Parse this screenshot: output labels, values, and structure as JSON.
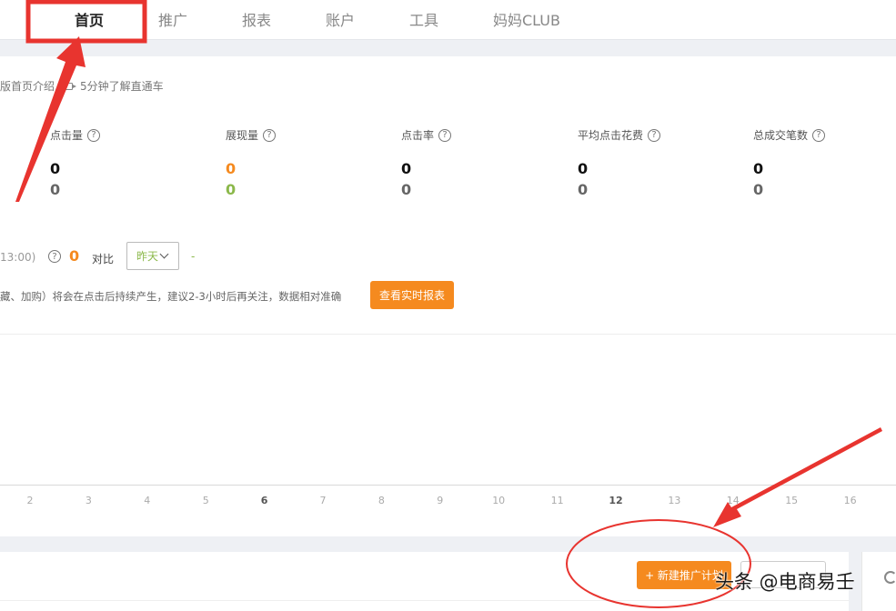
{
  "nav": {
    "items": [
      {
        "label": "首页",
        "active": true
      },
      {
        "label": "推广"
      },
      {
        "label": "报表"
      },
      {
        "label": "账户"
      },
      {
        "label": "工具"
      },
      {
        "label": "妈妈CLUB"
      }
    ]
  },
  "intro": {
    "home_intro": "版首页介绍",
    "video_link": "5分钟了解直通车"
  },
  "metrics": [
    {
      "label": "点击量",
      "today": "0",
      "yesterday": "0"
    },
    {
      "label": "展现量",
      "today": "0",
      "yesterday": "0"
    },
    {
      "label": "点击率",
      "today": "0",
      "yesterday": "0"
    },
    {
      "label": "平均点击花费",
      "today": "0",
      "yesterday": "0"
    },
    {
      "label": "总成交笔数",
      "today": "0",
      "yesterday": "0"
    }
  ],
  "realtime": {
    "time_range": "13:00)",
    "count": "0",
    "compare_label": "对比",
    "compare_value": "昨天",
    "dash": "-",
    "note": "藏、加购）将会在点击后持续产生，建议2-3小时后再关注，数据相对准确",
    "report_button": "查看实时报表"
  },
  "chart_axis": {
    "ticks": [
      "2",
      "3",
      "4",
      "5",
      "6",
      "7",
      "8",
      "9",
      "10",
      "11",
      "12",
      "13",
      "14",
      "15",
      "16"
    ],
    "bold_ticks": [
      "6",
      "12"
    ]
  },
  "bottom": {
    "new_plan_button": "+ 新建推广计划"
  },
  "watermark": "头条 @电商易壬",
  "colors": {
    "accent": "#f58a1f",
    "positive": "#8bb84a",
    "annotation": "#e8342f"
  }
}
